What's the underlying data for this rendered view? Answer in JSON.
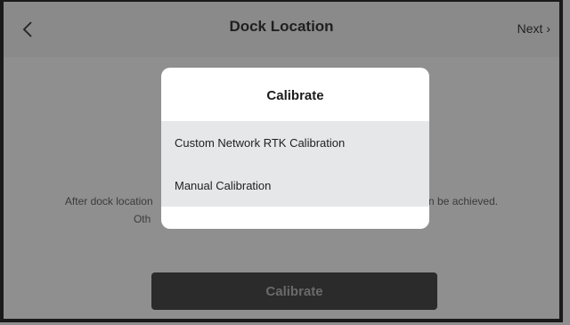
{
  "header": {
    "back_icon": "chevron-left-icon",
    "title": "Dock Location",
    "next_label": "Next",
    "next_icon": "chevron-right-icon"
  },
  "body": {
    "line1": "After dock location                                                                                         can be achieved.",
    "line2": "Oth                                                                                         ble"
  },
  "main_button": {
    "label": "Calibrate"
  },
  "modal": {
    "title": "Calibrate",
    "options": [
      {
        "label": "Custom Network RTK Calibration"
      },
      {
        "label": "Manual Calibration"
      }
    ]
  },
  "colors": {
    "overlay": "#8f8f8f",
    "modal_bg": "#ffffff",
    "option_bg": "#e6e7e9",
    "button_bg": "#2b2b2b"
  }
}
